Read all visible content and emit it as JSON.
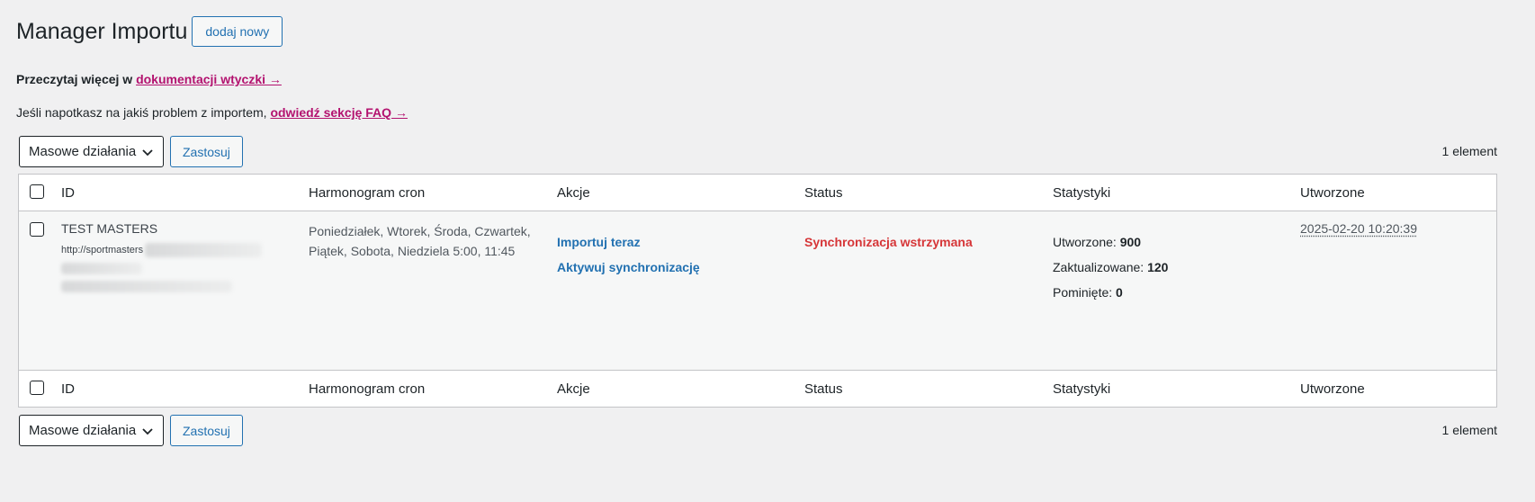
{
  "header": {
    "title": "Manager Importu",
    "add_new_label": "dodaj nowy"
  },
  "notices": {
    "docs_prefix": "Przeczytaj więcej w ",
    "docs_link": "dokumentacji wtyczki →",
    "faq_prefix": "Jeśli napotkasz na jakiś problem z importem, ",
    "faq_link": "odwiedź sekcję FAQ →"
  },
  "bulk_top": {
    "select_value": "Masowe działania",
    "apply_label": "Zastosuj",
    "count": "1 element"
  },
  "bulk_bottom": {
    "select_value": "Masowe działania",
    "apply_label": "Zastosuj",
    "count": "1 element"
  },
  "table": {
    "columns": [
      "ID",
      "Harmonogram cron",
      "Akcje",
      "Status",
      "Statystyki",
      "Utworzone"
    ],
    "rows": [
      {
        "name": "TEST MASTERS",
        "url": "http://sportmasters",
        "cron": "Poniedziałek, Wtorek, Środa, Czwartek, Piątek, Sobota, Niedziela 5:00, 11:45",
        "action_import": "Importuj teraz",
        "action_sync": "Aktywuj synchronizację",
        "status": "Synchronizacja wstrzymana",
        "stats": {
          "created_label": "Utworzone: ",
          "created_value": "900",
          "updated_label": "Zaktualizowane: ",
          "updated_value": "120",
          "skipped_label": "Pominięte: ",
          "skipped_value": "0"
        },
        "created_at": "2025-02-20 10:20:39"
      }
    ]
  },
  "colors": {
    "link": "#2271b1",
    "link_emphasis": "#b3126f",
    "status_paused": "#d63638",
    "background": "#f0f0f1"
  },
  "icons": [
    "chevron-down-icon",
    "checkbox-icon"
  ]
}
